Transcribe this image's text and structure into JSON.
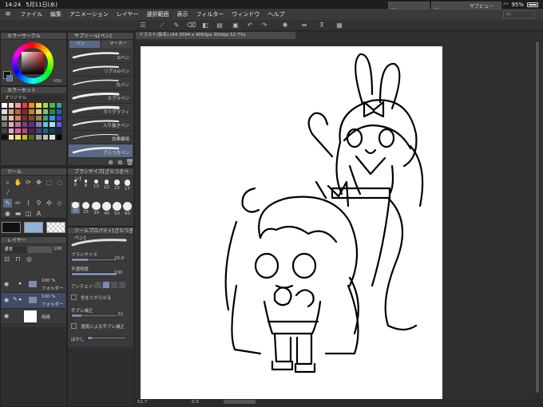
{
  "status": {
    "time": "14:24",
    "date": "5月11日(水)",
    "battery": "95%"
  },
  "menu": [
    "ファイル",
    "編集",
    "アニメーション",
    "レイヤー",
    "選択範囲",
    "表示",
    "フィルター",
    "ウィンドウ",
    "ヘルプ"
  ],
  "mini_windows": [
    "サブビュー"
  ],
  "color_panel": {
    "title": "カラーサークル",
    "hsv_label": "HSV"
  },
  "color_set": {
    "title": "カラーセット",
    "preset": "オリジナル",
    "colors": [
      "#fff",
      "#f8d9d9",
      "#f0a0a0",
      "#f04040",
      "#f09020",
      "#f8e040",
      "#a0e040",
      "#40c040",
      "#40a0a0",
      "#ddd",
      "#e0a080",
      "#c06040",
      "#a02020",
      "#c08040",
      "#e0c080",
      "#80c080",
      "#2a8a40",
      "#2060c0",
      "#aaa",
      "#f0c0a0",
      "#d08060",
      "#803020",
      "#805020",
      "#a08040",
      "#40a080",
      "#20a0e0",
      "#4040c0",
      "#777",
      "#e0b0c0",
      "#c070a0",
      "#804080",
      "#603080",
      "#8080c0",
      "#60c0e0",
      "#a0e0f0",
      "#6060e0",
      "#444",
      "#f0a0c0",
      "#e060a0",
      "#c04080",
      "#502050",
      "#404080",
      "#206080",
      "#104060",
      "#202050",
      "#111",
      "#fff0a0",
      "#f0e060",
      "#c0c020",
      "#606020",
      "#a0a0a0",
      "#c0c0c0",
      "#e0e0e0",
      "#000"
    ]
  },
  "tool_panel": {
    "title": "ツール"
  },
  "subtool_panel": {
    "title": "サブツール[ペン]",
    "tabs": [
      "ペン",
      "マーカー"
    ],
    "brushes": [
      "Gペン",
      "リアルGペン",
      "丸ペン",
      "カブラペン",
      "カリグラフィ",
      "入り抜きペン",
      "効果線用",
      "ざらつきペン"
    ]
  },
  "brush_size_panel": {
    "title": "ブラシサイズ[ざらつきペン]",
    "sizes": [
      "6",
      "8",
      "10",
      "12",
      "15",
      "17",
      "20",
      "25",
      "30",
      "40",
      "50",
      "60"
    ]
  },
  "tool_property": {
    "title": "ツールプロパティ[ざらつきペン]",
    "brush_size_label": "ブラシサイズ",
    "brush_size_value": "20.0",
    "opacity_label": "不透明度",
    "opacity_value": "100",
    "antialias_label": "アンチエイリアス",
    "color_gap_label": "色をとがらせる",
    "stabilization_label": "手ブレ補正",
    "stabilization_value": "22",
    "speed_label": "速度による手ブレ補正",
    "smear_label": "ぼかし"
  },
  "layer_panel": {
    "title": "レイヤー",
    "blend_mode": "通常",
    "opacity": "100",
    "layers": [
      {
        "percent": "100 %",
        "name": "フォルダー"
      },
      {
        "percent": "100 %",
        "name": "フォルダー"
      },
      {
        "percent": "",
        "name": "用紙"
      }
    ]
  },
  "canvas": {
    "tab_title": "イラスト(仮名) (A4 3594 x 4093px 350dpi 52.7%)",
    "zoom": "52.7",
    "rotation": "0.0"
  }
}
